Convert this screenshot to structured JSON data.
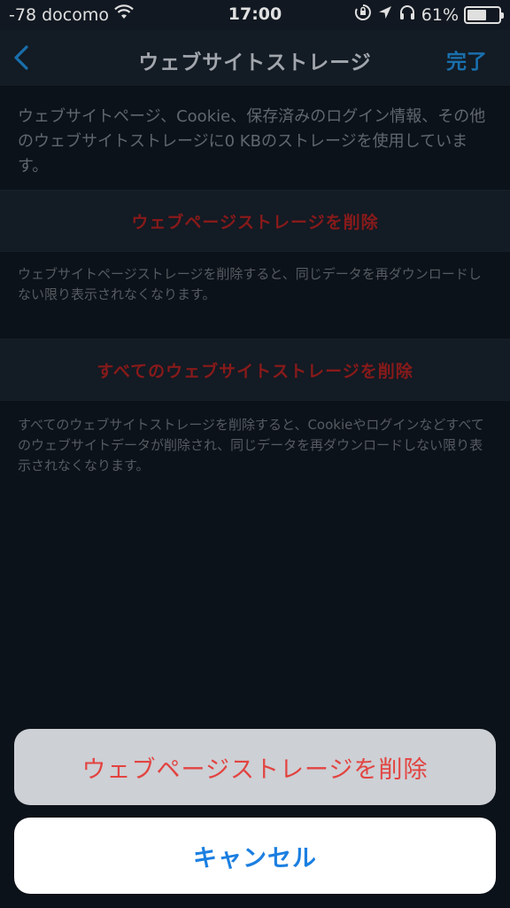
{
  "status_bar": {
    "signal": "-78 docomo",
    "time": "17:00",
    "battery_percent": "61%",
    "battery_level": 0.61
  },
  "nav": {
    "title": "ウェブサイトストレージ",
    "done_label": "完了"
  },
  "storage": {
    "summary": "ウェブサイトページ、Cookie、保存済みのログイン情報、その他のウェブサイトストレージに0 KBのストレージを使用しています。",
    "delete_web_pages_label": "ウェブページストレージを削除",
    "delete_web_pages_footer": "ウェブサイトページストレージを削除すると、同じデータを再ダウンロードしない限り表示されなくなります。",
    "delete_all_label": "すべてのウェブサイトストレージを削除",
    "delete_all_footer": "すべてのウェブサイトストレージを削除すると、Cookieやログインなどすべてのウェブサイトデータが削除され、同じデータを再ダウンロードしない限り表示されなくなります。"
  },
  "action_sheet": {
    "destructive_label": "ウェブページストレージを削除",
    "cancel_label": "キャンセル"
  },
  "colors": {
    "accent": "#1d7fc4",
    "destructive_cell": "#9b1e1e",
    "destructive_sheet": "#e24441",
    "cancel": "#1b7fe1"
  },
  "icons": {
    "status": [
      "wifi-icon",
      "orientation-lock-icon",
      "location-arrow-icon",
      "headphones-icon",
      "battery-icon"
    ],
    "nav": [
      "chevron-left-icon"
    ]
  }
}
